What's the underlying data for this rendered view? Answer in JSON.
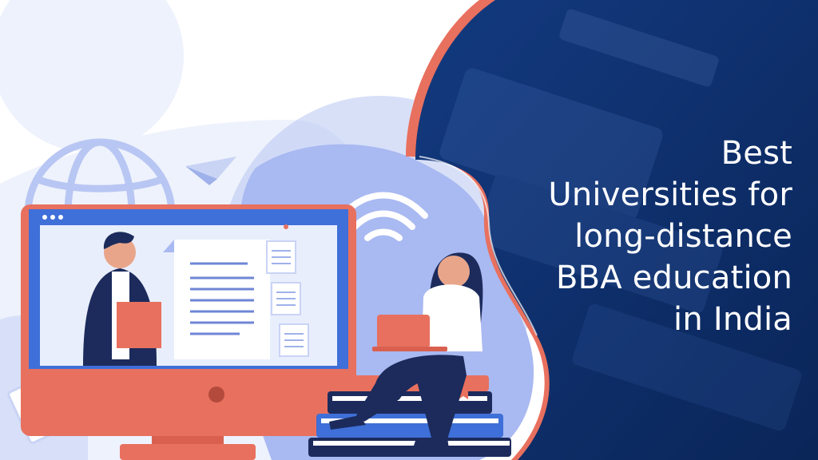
{
  "headline": {
    "lines": [
      "Best",
      "Universities for",
      "long-distance",
      "BBA education",
      "in India"
    ]
  },
  "colors": {
    "navy": "#0d2f6e",
    "navy_dark": "#0a2558",
    "coral": "#e8705e",
    "periwinkle": "#a8b8f0",
    "light_blue": "#e9eefc",
    "screen_blue": "#3f6fd8",
    "text_white": "#ffffff"
  },
  "icons": [
    "globe-icon",
    "paper-plane-icon",
    "wifi-icon",
    "paperclip-icon"
  ]
}
